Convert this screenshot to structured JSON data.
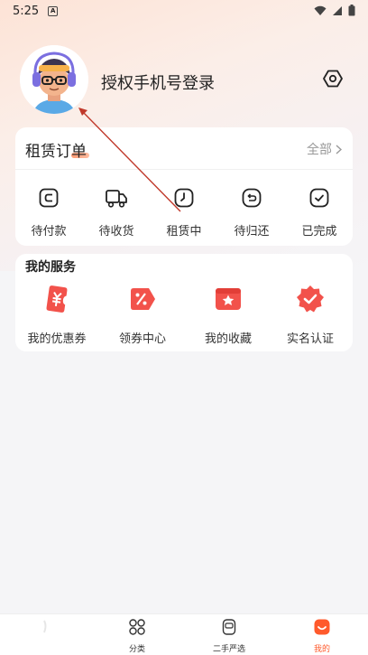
{
  "status_bar": {
    "time": "5:25",
    "notification_glyph": "A"
  },
  "profile": {
    "login_text": "授权手机号登录"
  },
  "orders": {
    "title": "租赁订单",
    "all_label": "全部",
    "items": [
      {
        "label": "待付款",
        "icon": "wallet-icon"
      },
      {
        "label": "待收货",
        "icon": "truck-icon"
      },
      {
        "label": "租赁中",
        "icon": "clock-icon"
      },
      {
        "label": "待归还",
        "icon": "return-icon"
      },
      {
        "label": "已完成",
        "icon": "check-icon"
      }
    ]
  },
  "services": {
    "title": "我的服务",
    "items": [
      {
        "label": "我的优惠券",
        "icon": "coupon-icon"
      },
      {
        "label": "领券中心",
        "icon": "discount-icon"
      },
      {
        "label": "我的收藏",
        "icon": "favorite-icon"
      },
      {
        "label": "实名认证",
        "icon": "verify-icon"
      }
    ]
  },
  "tabs": [
    {
      "label": "",
      "icon": "home-icon"
    },
    {
      "label": "分类",
      "icon": "category-icon"
    },
    {
      "label": "二手严选",
      "icon": "secondhand-icon"
    },
    {
      "label": "我的",
      "icon": "mine-icon",
      "active": true
    }
  ],
  "colors": {
    "accent": "#ff5a2c",
    "annotation": "#c0392b"
  }
}
